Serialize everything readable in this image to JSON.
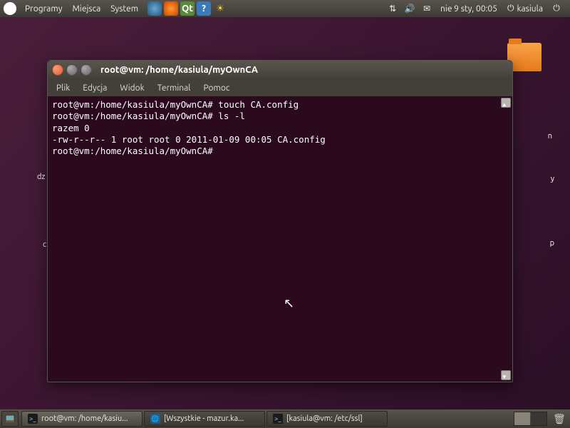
{
  "top_panel": {
    "menus": [
      "Programy",
      "Miejsca",
      "System"
    ],
    "clock": "nie  9 sty, 00:05",
    "user": "kasiula"
  },
  "desktop": {
    "labels": {
      "dz": "dz",
      "c": "c",
      "n": "n",
      "y": "y",
      "p": "p"
    }
  },
  "terminal": {
    "title": "root@vm: /home/kasiula/myOwnCA",
    "menus": [
      "Plik",
      "Edycja",
      "Widok",
      "Terminal",
      "Pomoc"
    ],
    "lines": [
      "root@vm:/home/kasiula/myOwnCA# touch CA.config",
      "root@vm:/home/kasiula/myOwnCA# ls -l",
      "razem 0",
      "-rw-r--r-- 1 root root 0 2011-01-09 00:05 CA.config",
      "root@vm:/home/kasiula/myOwnCA# "
    ]
  },
  "taskbar": {
    "tasks": [
      {
        "label": "root@vm: /home/kasiu..."
      },
      {
        "label": "[Wszystkie - mazur.ka..."
      },
      {
        "label": "[kasiula@vm: /etc/ssl]"
      }
    ]
  }
}
